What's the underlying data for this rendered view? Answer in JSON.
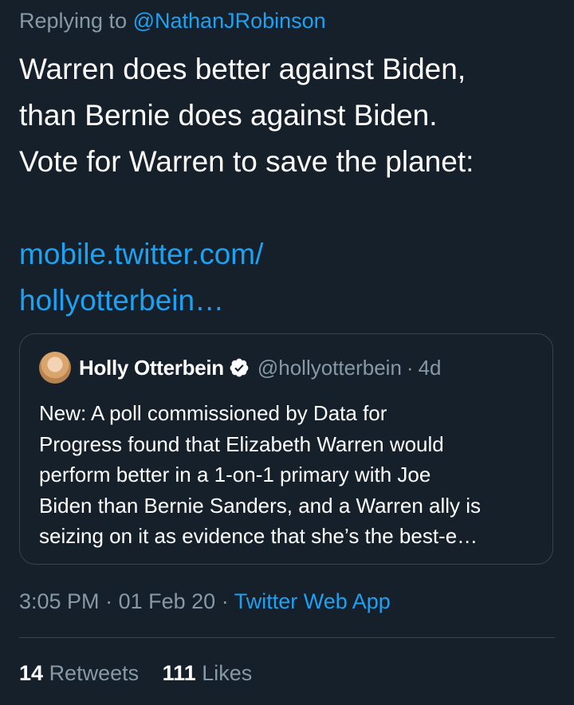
{
  "reply": {
    "prefix": "Replying to",
    "handle": "@NathanJRobinson"
  },
  "tweet": {
    "lines": [
      "Warren does better against Biden,",
      "than Bernie does against Biden.",
      "Vote for Warren to save the planet:"
    ],
    "link_lines": [
      "mobile.twitter.com/",
      "hollyotterbein…"
    ]
  },
  "quote": {
    "avatar_icon": "profile-photo",
    "name": "Holly Otterbein",
    "verified_icon": "verified-badge-icon",
    "handle": "@hollyotterbein",
    "separator": "·",
    "age": "4d",
    "text_lines": [
      "New: A poll commissioned by Data for",
      "Progress found that Elizabeth Warren would",
      "perform better in a 1-on-1 primary with Joe",
      "Biden than Bernie Sanders, and a Warren ally is",
      "seizing on it as evidence that she’s the best-e…"
    ]
  },
  "meta": {
    "time": "3:05 PM",
    "sep1": "·",
    "date": "01 Feb 20",
    "sep2": "·",
    "source": "Twitter Web App"
  },
  "stats": {
    "retweets_count": "14",
    "retweets_label": "Retweets",
    "likes_count": "111",
    "likes_label": "Likes"
  },
  "colors": {
    "background": "#15202b",
    "accent": "#1da1f2",
    "muted": "#8899a6",
    "border": "#38444d"
  }
}
